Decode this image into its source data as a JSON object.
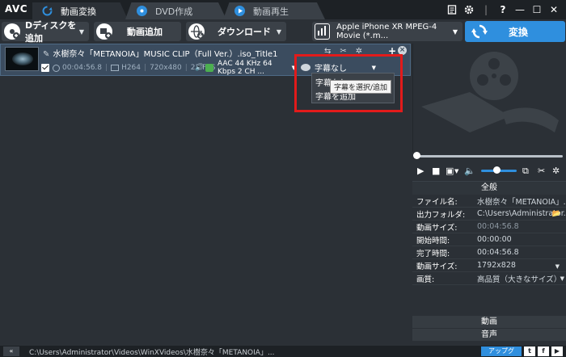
{
  "app": {
    "logo": "AVC"
  },
  "tabs": [
    {
      "label": "動画変換",
      "active": true
    },
    {
      "label": "DVD作成",
      "active": false
    },
    {
      "label": "動画再生",
      "active": false
    }
  ],
  "window_controls": {
    "help": "?",
    "minimize": "—",
    "maximize": "☐",
    "close": "✕"
  },
  "toolbar": {
    "disc_add": "Dディスクを追加",
    "video_add": "動画追加",
    "download": "ダウンロード",
    "profile": "Apple iPhone XR MPEG-4 Movie (*.m...",
    "convert": "変換"
  },
  "file": {
    "name": "水樹奈々「METANOIA」MUSIC CLIP（Full Ver.）.iso_Title1",
    "duration": "00:04:56.8",
    "codec": "H264",
    "resolution": "720x480",
    "fps": "23 FPS",
    "audio": "AAC 44 KHz 64 Kbps 2 CH ...",
    "subtitle": "字幕なし"
  },
  "subtitle_menu": {
    "options": [
      "字幕なし",
      "字幕を追加"
    ],
    "tooltip": "字幕を選択/追加"
  },
  "properties": {
    "header": "全般",
    "rows": [
      {
        "key": "ファイル名:",
        "value": "水樹奈々「METANOIA」...",
        "dim": false
      },
      {
        "key": "出力フォルダ:",
        "value": "C:\\Users\\Administrator...",
        "dim": false
      },
      {
        "key": "動画サイズ:",
        "value": "00:04:56.8",
        "dim": true
      },
      {
        "key": "開始時間:",
        "value": "00:00:00",
        "dim": false
      },
      {
        "key": "完了時間:",
        "value": "00:04:56.8",
        "dim": false
      },
      {
        "key": "動画サイズ:",
        "value": "1792x828",
        "dim": false
      },
      {
        "key": "画質:",
        "value": "高品質（大きなサイズ）",
        "dim": false
      }
    ]
  },
  "sections": {
    "video": "動画",
    "audio": "音声"
  },
  "statusbar": {
    "path": "C:\\Users\\Administrator\\Videos\\WinXVideos\\水樹奈々「METANOIA」...",
    "upgrade": "アップグ"
  }
}
